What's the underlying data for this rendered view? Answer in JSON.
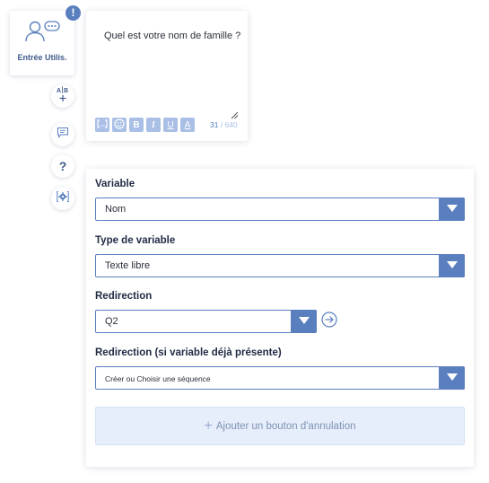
{
  "node": {
    "label": "Entrée Utilis.",
    "alert": "!"
  },
  "side_buttons": {
    "help": "?"
  },
  "message": {
    "text": "Quel est votre nom de famille ?",
    "format_buttons": {
      "bold": "B",
      "italic": "I",
      "underline": "U",
      "color": "A"
    },
    "char_count": "31",
    "char_max": "/ 640"
  },
  "form": {
    "variable": {
      "label": "Variable",
      "value": "Nom"
    },
    "variable_type": {
      "label": "Type de variable",
      "value": "Texte libre"
    },
    "redirect": {
      "label": "Redirection",
      "value": "Q2"
    },
    "redirect_existing": {
      "label": "Redirection (si variable déjà présente)",
      "value": "Créer ou Choisir une séquence"
    },
    "cancel_button": {
      "plus": "+",
      "label": "Ajouter un bouton d'annulation"
    }
  },
  "colors": {
    "accent": "#5a7fbf",
    "accent_light": "#a9bfe6",
    "panel_bg": "#e6eefb"
  }
}
